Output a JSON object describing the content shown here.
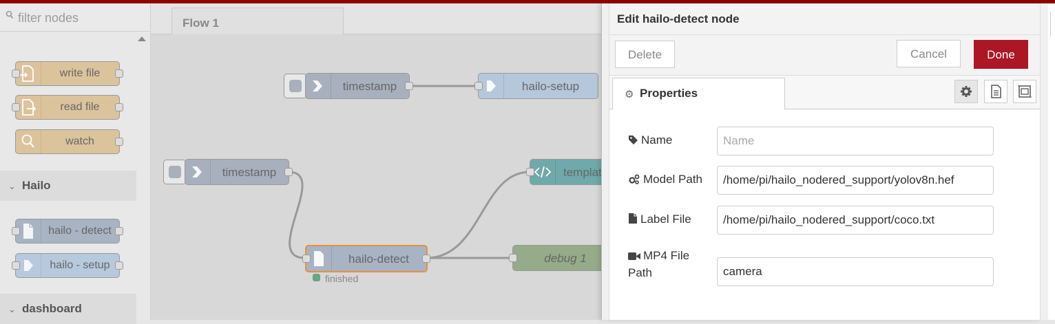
{
  "palette": {
    "filter_placeholder": "filter nodes",
    "nodes_storage": [
      {
        "label": "write file",
        "icon": "write-file-icon",
        "color": "#dbc39c"
      },
      {
        "label": "read file",
        "icon": "read-file-icon",
        "color": "#dbc39c"
      },
      {
        "label": "watch",
        "icon": "search-icon",
        "color": "#dbc39c"
      }
    ],
    "category_hailo": "Hailo",
    "nodes_hailo": [
      {
        "label": "hailo - detect",
        "icon": "file-icon",
        "color": "#a8b3c4"
      },
      {
        "label": "hailo - setup",
        "icon": "arrow-right-icon",
        "color": "#b7c9dd"
      }
    ],
    "category_dashboard": "dashboard"
  },
  "workspace": {
    "tab_label": "Flow 1",
    "nodes": {
      "timestamp1": "timestamp",
      "hailo_setup": "hailo-setup",
      "timestamp2": "timestamp",
      "template": "template",
      "hailo_detect": "hailo-detect",
      "debug": "debug 1"
    },
    "status_text": "finished",
    "colors": {
      "inject": "#a8b0be",
      "hailo_setup": "#b5c7db",
      "template": "#6fa9aa",
      "hailo_detect": "#a8b3c4",
      "debug": "#95ab89",
      "selected_border": "#e69138"
    }
  },
  "tray": {
    "title": "Edit hailo-detect node",
    "delete_label": "Delete",
    "cancel_label": "Cancel",
    "done_label": "Done",
    "tab_properties": "Properties",
    "fields": {
      "name_label": "Name",
      "name_placeholder": "Name",
      "name_value": "",
      "model_label": "Model Path",
      "model_value": "/home/pi/hailo_nodered_support/yolov8n.hef",
      "labelfile_label": "Label File",
      "labelfile_value": "/home/pi/hailo_nodered_support/coco.txt",
      "mp4_label_line1": "MP4 File",
      "mp4_label_line2": "Path",
      "mp4_value": "camera"
    }
  }
}
